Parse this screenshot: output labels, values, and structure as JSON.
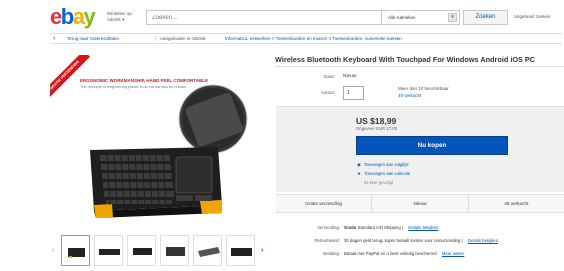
{
  "header": {
    "logo": [
      {
        "ch": "e",
        "color": "#e53238"
      },
      {
        "ch": "b",
        "color": "#0064d2"
      },
      {
        "ch": "a",
        "color": "#f5af02"
      },
      {
        "ch": "y",
        "color": "#86b817"
      }
    ],
    "shop_by_line1": "Winkelen op",
    "shop_by_line2": "rubriek",
    "search_placeholder": "Zoeken...",
    "category_select": "Alle rubrieken",
    "search_button": "Zoeken",
    "advanced_link": "Uitgebreid zoeken"
  },
  "breadcrumb": {
    "back": "Terug naar zoekresultaten",
    "listed_in": "Aangeboden in rubriek:",
    "categories": "Informatica, netwerken > Toetsenborden en muizen > Toetsenborden, numerieke toetsen"
  },
  "image": {
    "ribbon": "GRATIS VERZENDING",
    "promo_line1": "ERGONOMIC WORKMANSHIP, HAND FEEL COMFORTABLE",
    "promo_line2": "The principle of engineering plastic is do not harmful for human."
  },
  "product": {
    "title": "Wireless Bluetooth Keyboard With Touchpad For Windows Android iOS PC",
    "condition_label": "Staat:",
    "condition_value": "Nieuw",
    "quantity_label": "Aantal:",
    "quantity_value": "1",
    "availability": "Meer dan 10 beschikbaar",
    "sold": "49 verkocht",
    "price": "US $18,99",
    "approx_price": "Ongeveer EUR 17,00",
    "buy_button": "Nu kopen",
    "watchlist_link": "Toevoegen aan volglijst",
    "collection_link": "Toevoegen aan collectie",
    "watchers": "83 keer gevolgd"
  },
  "stats": [
    "Gratis verzending",
    "Nieuw",
    "49 verkocht"
  ],
  "details": {
    "shipping_label": "Verzending:",
    "shipping_bold": "Gratis",
    "shipping_text": "Standard Int'l Shipping |",
    "shipping_link": "Details bekijken",
    "returns_label": "Retourbeleid:",
    "returns_text": "30 dagen geld terug, koper betaalt kosten voor retourzending |",
    "returns_link": "Details bekijken",
    "payments_label": "Betaling:",
    "payments_text": "Betaal met PayPal en u bent volledig beschermd",
    "payments_link": "Meer weten"
  }
}
